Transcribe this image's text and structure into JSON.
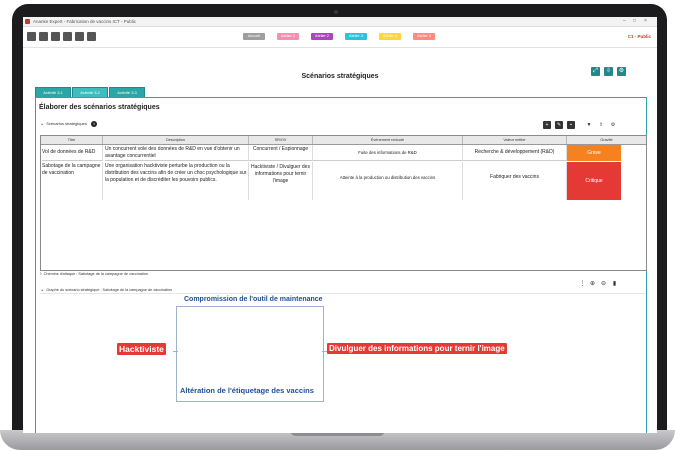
{
  "app": {
    "title": "Ananke Expert - Fabrication de vaccins ICT - Public",
    "user_badge": "C1 - Public"
  },
  "toolbar": {
    "icons": [
      "new-file-icon",
      "open-folder-icon",
      "save-icon",
      "save-as-icon",
      "download-icon",
      "settings-icon"
    ],
    "steps": [
      {
        "label": "Accueil",
        "color": "#9e9e9e"
      },
      {
        "label": "Atelier 1",
        "color": "#f48fb1"
      },
      {
        "label": "Atelier 2",
        "color": "#ab47bc"
      },
      {
        "label": "Atelier 3",
        "color": "#26c6da"
      },
      {
        "label": "Atelier 4",
        "color": "#fdd835"
      },
      {
        "label": "Atelier 5",
        "color": "#ff8a80"
      }
    ]
  },
  "page": {
    "title": "Scénarios stratégiques",
    "tabs": [
      "Activité 3.1",
      "Activité 3.2",
      "Activité 3.3"
    ],
    "panel_title": "Élaborer des scénarios stratégiques",
    "section_title": "Scénarios stratégiques"
  },
  "table": {
    "headers": [
      "Titre",
      "Description",
      "SR/OV",
      "Événement redouté",
      "Valeur métier",
      "Gravité"
    ],
    "rows": [
      {
        "title": "Vol de données de R&D",
        "description": "Un concurrent vole des données de R&D en vue d'obtenir un avantage concurrentiel",
        "srov": "Concurrent / Espionnage",
        "event": "Fuite des informations de R&D",
        "value": "Recherche & développement (R&D)",
        "severity": "Grave",
        "severity_color": "#f5821f"
      },
      {
        "title": "Sabotage de la campagne de vaccination",
        "description": "Une organisation hacktiviste perturbe la production ou la distribution des vaccins afin de créer un choc psychologique sur la population et de discréditer les pouvoirs publics.",
        "srov": "Hacktiviste / Divulguer des informations pour ternir l'image",
        "event": "Atteinte à la production ou distribution des vaccins",
        "value": "Fabriquer des vaccins",
        "severity": "Critique",
        "severity_color": "#e53935"
      }
    ]
  },
  "sections": {
    "attack_chain": "Chemins d'attaque : Sabotage de la campagne de vaccination",
    "graph_title": "Graphe du scénario stratégique : Sabotage de la campagne de vaccination"
  },
  "graph": {
    "source": "Hacktiviste",
    "target": "Divulguer des informations pour ternir l'image",
    "top_label": "Compromission de l'outil de maintenance",
    "bottom_label": "Altération de l'étiquetage des vaccins"
  }
}
